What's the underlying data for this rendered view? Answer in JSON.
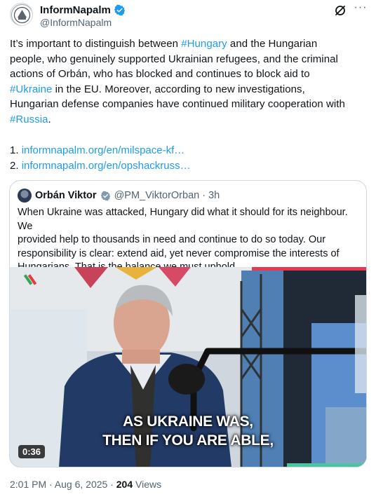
{
  "author": {
    "display_name": "InformNapalm",
    "handle": "@InformNapalm"
  },
  "tweet": {
    "p1": "It’s important to distinguish between ",
    "tag_hungary": "#Hungary",
    "p2": " and the Hungarian",
    "line2": "people, who genuinely supported Ukrainian refugees, and the criminal",
    "line3": "actions of Orbán, who has blocked and continues to block aid to",
    "tag_ukraine": "#Ukraine",
    "p3": " in the EU. Moreover, according to new investigations,",
    "line5": "Hungarian defense companies have continued military cooperation with",
    "tag_russia": "#Russia",
    "p4": "."
  },
  "links": [
    {
      "num": "1. ",
      "url": "informnapalm.org/en/milspace-kf…"
    },
    {
      "num": "2. ",
      "url": "informnapalm.org/en/opshackruss…"
    }
  ],
  "quote": {
    "name": "Orbán Viktor",
    "handle": "@PM_ViktorOrban · 3h",
    "lines": [
      "When Ukraine was attacked, Hungary did what it should for its neighbour. We",
      "provided help to thousands in need and continue to do so today. Our",
      "responsibility is clear: extend aid, yet never compromise the interests of",
      "Hungarians. That is the balance we must uphold."
    ],
    "video": {
      "caption_1": "AS UKRAINE WAS,",
      "caption_2": "THEN IF YOU ARE ABLE,",
      "duration": "0:36"
    }
  },
  "meta": {
    "timestamp": "2:01 PM · Aug 6, 2025 · ",
    "views_count": "204",
    "views_label": " Views"
  },
  "colors": {
    "link": "#1d9bf0",
    "verified": "#1d9bf0",
    "secondary_text": "#536471"
  }
}
